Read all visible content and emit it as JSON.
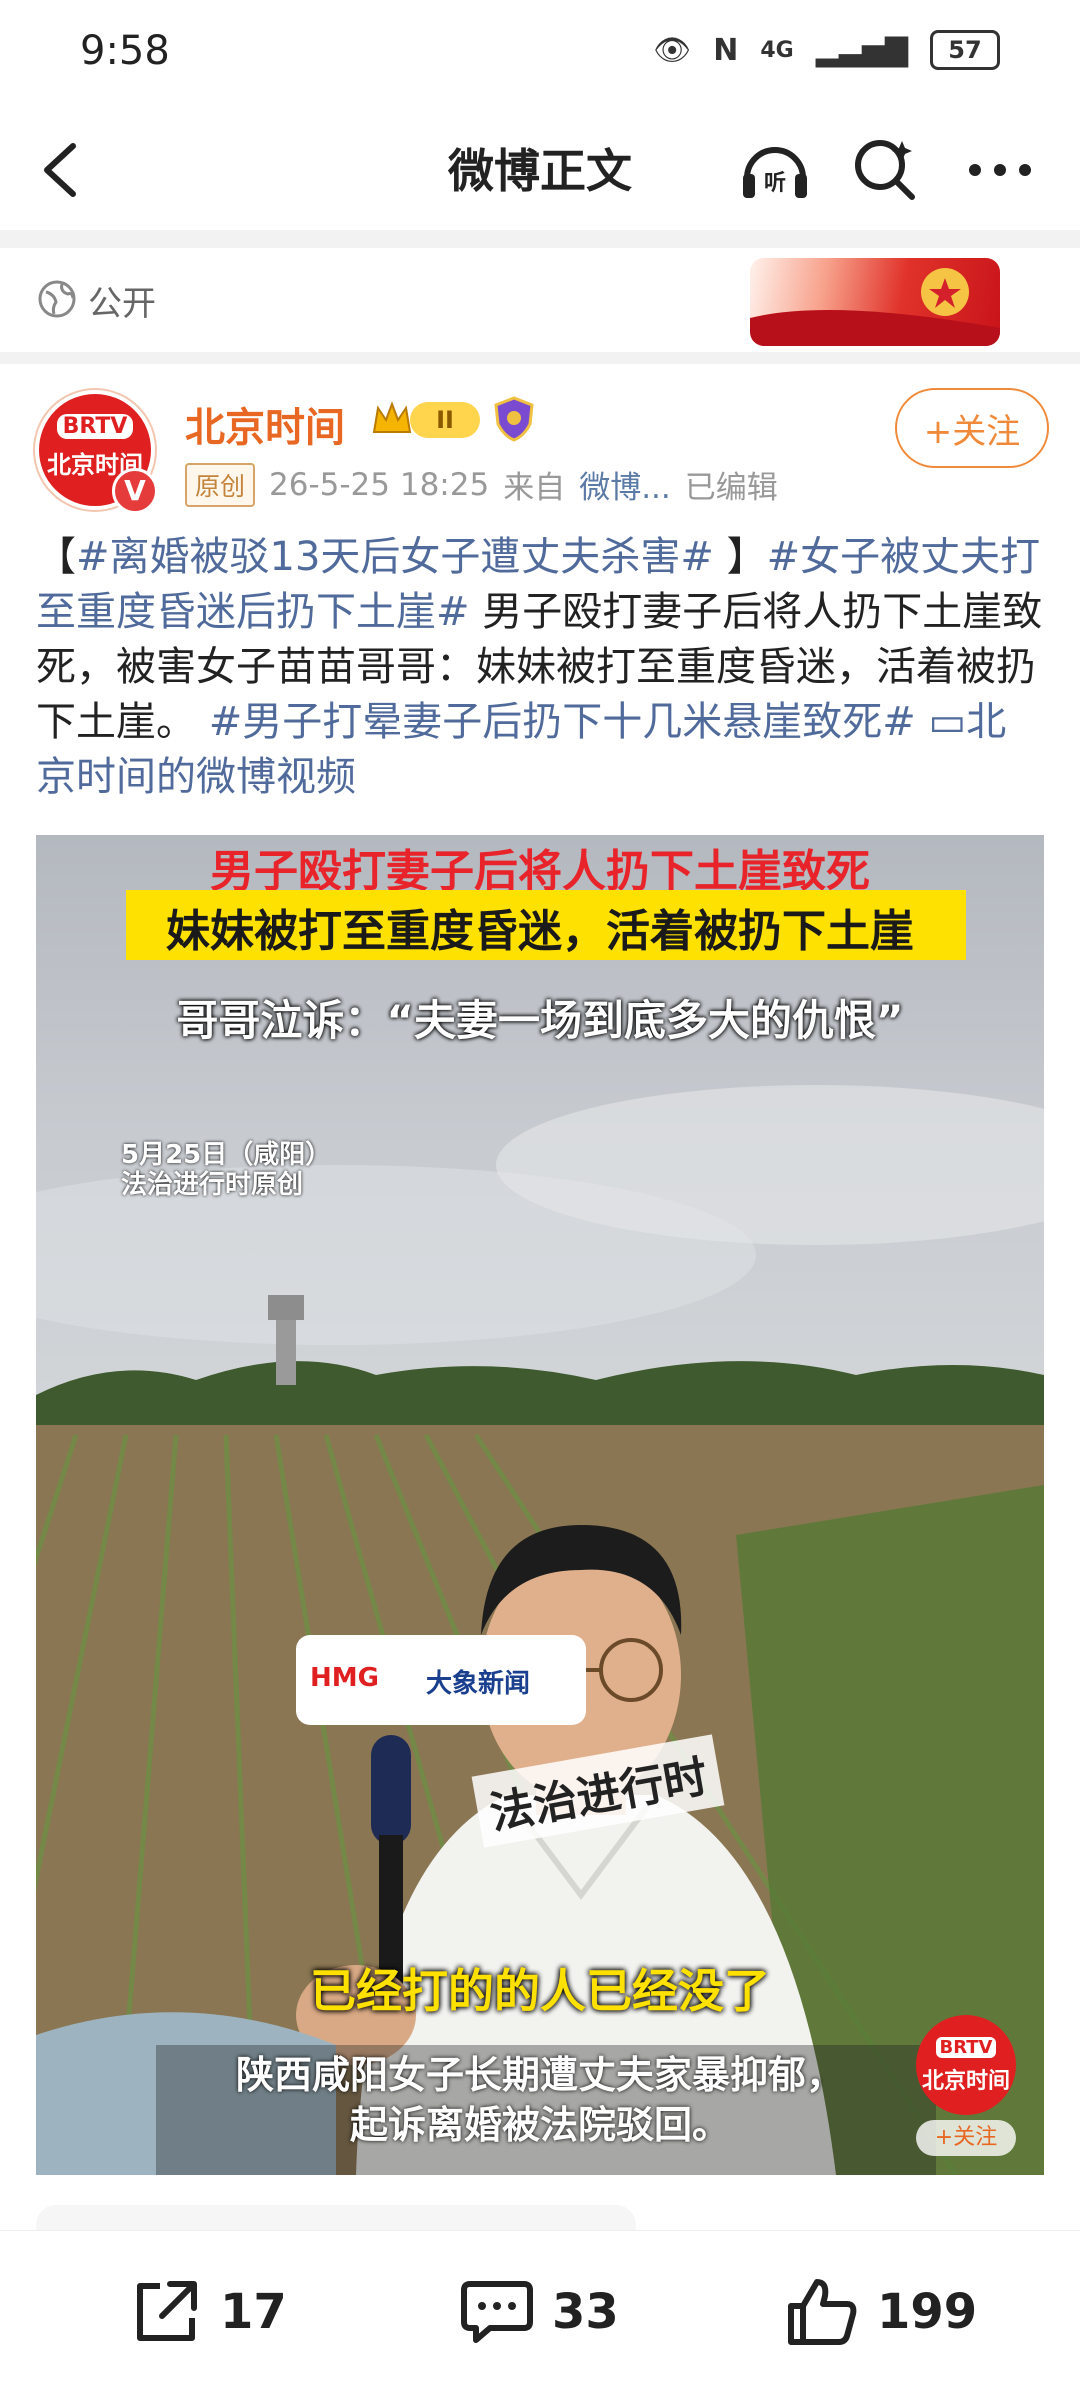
{
  "status_bar": {
    "time": "9:58",
    "network": "4G",
    "battery": "57"
  },
  "nav": {
    "title": "微博正文",
    "back_icon": "back-arrow-icon",
    "listen_label": "听"
  },
  "privacy": {
    "label": "公开"
  },
  "post": {
    "author": "北京时间",
    "level": "II",
    "follow_label": "+关注",
    "original_tag": "原创",
    "timestamp": "26-5-25 18:25",
    "source_prefix": "来自",
    "source": "微博...",
    "edited": "已编辑",
    "avatar_text": "BRTV",
    "avatar_name": "北京时间",
    "text_parts": [
      {
        "type": "plain",
        "text": "【"
      },
      {
        "type": "topic",
        "text": "#离婚被驳13天后女子遭丈夫杀害#"
      },
      {
        "type": "plain",
        "text": " 】"
      },
      {
        "type": "topic",
        "text": "#女子被丈夫打至重度昏迷后扔下土崖#"
      },
      {
        "type": "plain",
        "text": " 男子殴打妻子后将人扔下土崖致死，被害女子苗苗哥哥：妹妹被打至重度昏迷，活着被扔下土崖。 "
      },
      {
        "type": "topic",
        "text": "#男子打晕妻子后扔下十几米悬崖致死#"
      },
      {
        "type": "plain",
        "text": " "
      },
      {
        "type": "topic",
        "text": "▭北京时间的微博视频"
      }
    ]
  },
  "video": {
    "caption_1": "男子殴打妻子后将人扔下土崖致死",
    "caption_2": "妹妹被打至重度昏迷，活着被扔下土崖",
    "caption_3": "哥哥泣诉：“夫妻一场到底多大的仇恨”",
    "date_line": "5月25日（咸阳）",
    "program_line": "法治进行时原创",
    "subtitle_1": "已经打的的人已经没了",
    "subtitle_2_line1": "陕西咸阳女子长期遭丈夫家暴抑郁，",
    "subtitle_2_line2": "起诉离婚被法院驳回。",
    "mic_brand_1": "HMG",
    "mic_brand_2": "大象新闻",
    "watermark": "北京时间",
    "watermark_follow": "+关注",
    "program_logo": "法治进行时"
  },
  "actions": {
    "reposts": "17",
    "comments": "33",
    "likes": "199"
  },
  "colors": {
    "accent": "#f08a3a",
    "topic": "#506b9b",
    "author": "#e86722"
  }
}
